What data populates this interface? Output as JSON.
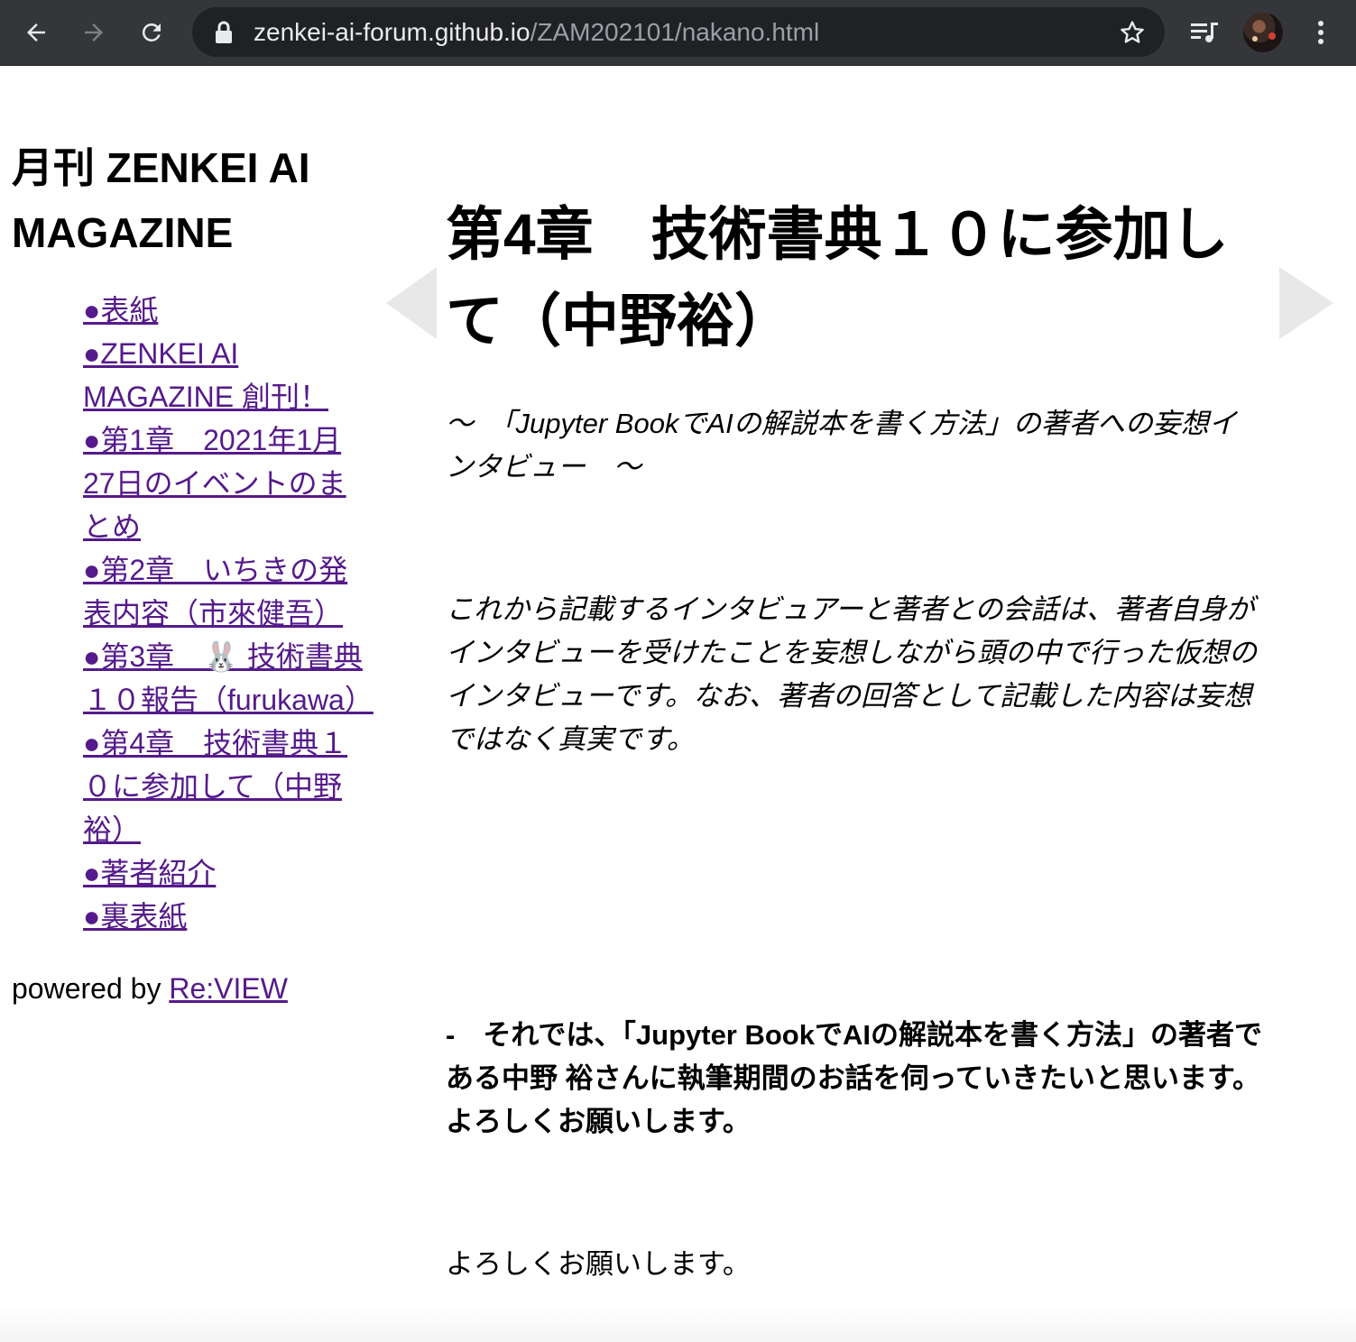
{
  "browser": {
    "url_host": "zenkei-ai-forum.github.io",
    "url_path": "/ZAM202101/nakano.html",
    "back_icon": "arrow-left-icon",
    "forward_icon": "arrow-right-icon",
    "reload_icon": "reload-icon",
    "lock_icon": "lock-icon",
    "bookmark_icon": "star-icon",
    "media_icon": "media-queue-icon",
    "menu_icon": "kebab-menu-icon"
  },
  "sidebar": {
    "magazine_title": "月刊 ZENKEI AI MAGAZINE",
    "toc": [
      "●表紙",
      "●ZENKEI AI MAGAZINE 創刊！",
      "●第1章　2021年1月27日のイベントのまとめ",
      "●第2章　いちきの発表内容（市來健吾）",
      "●第3章　🐰 技術書典１０報告（furukawa）",
      "●第4章　技術書典１０に参加して（中野裕）",
      "●著者紹介",
      "●裏表紙"
    ],
    "powered_by_prefix": "powered by ",
    "powered_by_link": "Re:VIEW"
  },
  "main": {
    "chapter_title": "第4章　技術書典１０に参加して（中野裕）",
    "subtitle": "～　「Jupyter BookでAIの解説本を書く方法」の著者への妄想インタビュー　～",
    "disclaimer": "これから記載するインタビュアーと著者との会話は、著者自身がインタビューを受けたことを妄想しながら頭の中で行った仮想のインタビューです。なお、著者の回答として記載した内容は妄想ではなく真実です。",
    "question": "-　それでは、「Jupyter BookでAIの解説本を書く方法」の著者である中野 裕さんに執筆期間のお話を伺っていきたいと思います。よろしくお願いします。",
    "answer": "よろしくお願いします。"
  },
  "nav": {
    "prev_icon": "prev-page-triangle-icon",
    "next_icon": "next-page-triangle-icon"
  }
}
